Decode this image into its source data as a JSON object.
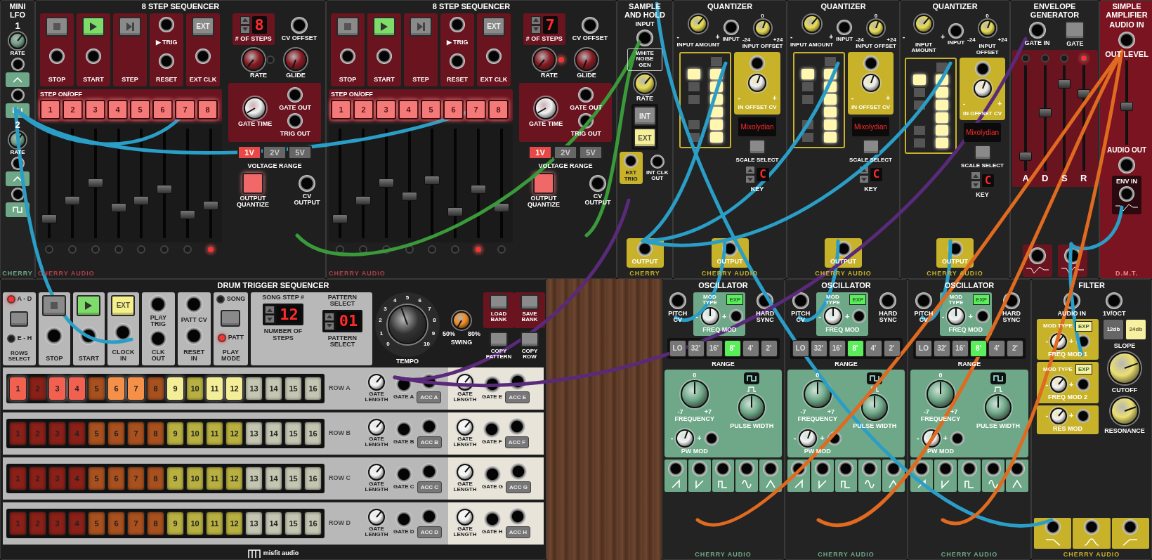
{
  "mini_lfo": {
    "title": "MINI LFO",
    "channels": [
      {
        "number": "1",
        "label": "RATE"
      },
      {
        "number": "2",
        "label": "RATE"
      }
    ],
    "brand": "CHERRY"
  },
  "step_sequencers": [
    {
      "title": "8 STEP SEQUENCER",
      "transport": [
        {
          "kind": "stop",
          "label": "STOP",
          "lit": false
        },
        {
          "kind": "start",
          "label": "START",
          "lit": true
        },
        {
          "kind": "step",
          "label": "STEP",
          "lit": false
        },
        {
          "kind": "reset",
          "label": "RESET",
          "trig": "▶ TRIG"
        },
        {
          "kind": "ext",
          "label": "EXT CLK",
          "button": "EXT",
          "lit": false
        }
      ],
      "steps_count": "8",
      "steps_label": "# OF STEPS",
      "cv_offset": "CV OFFSET",
      "rate": "RATE",
      "rate_led": false,
      "glide": "GLIDE",
      "step_onoff": "STEP ON/OFF",
      "steps": [
        {
          "label": "1",
          "on": true
        },
        {
          "label": "2",
          "on": true
        },
        {
          "label": "3",
          "on": true
        },
        {
          "label": "4",
          "on": true
        },
        {
          "label": "5",
          "on": true
        },
        {
          "label": "6",
          "on": true
        },
        {
          "label": "7",
          "on": true
        },
        {
          "label": "8",
          "on": true
        }
      ],
      "sliders": [
        {
          "level": 0.15
        },
        {
          "level": 0.33
        },
        {
          "level": 0.5
        },
        {
          "level": 0.26
        },
        {
          "level": 0.33
        },
        {
          "level": 0.44
        },
        {
          "level": 0.19
        },
        {
          "level": 0.28
        }
      ],
      "leds": [
        {
          "on": false
        },
        {
          "on": false
        },
        {
          "on": false
        },
        {
          "on": false
        },
        {
          "on": false
        },
        {
          "on": false
        },
        {
          "on": false
        },
        {
          "on": true
        }
      ],
      "gate_time": "GATE TIME",
      "gate_out": "GATE OUT",
      "trig_out": "TRIG OUT",
      "ranges": [
        {
          "label": "1V",
          "selected": true
        },
        {
          "label": "2V",
          "selected": false
        },
        {
          "label": "5V",
          "selected": false
        }
      ],
      "voltage_range": "VOLTAGE RANGE",
      "output_quantize": "OUTPUT QUANTIZE",
      "cv_output": "CV OUTPUT",
      "brand": "CHERRY AUDIO"
    },
    {
      "title": "8 STEP SEQUENCER",
      "transport": [
        {
          "kind": "stop",
          "label": "STOP",
          "lit": false
        },
        {
          "kind": "start",
          "label": "START",
          "lit": true
        },
        {
          "kind": "step",
          "label": "STEP",
          "lit": false
        },
        {
          "kind": "reset",
          "label": "RESET",
          "trig": "▶ TRIG"
        },
        {
          "kind": "ext",
          "label": "EXT CLK",
          "button": "EXT",
          "lit": false
        }
      ],
      "steps_count": "7",
      "steps_label": "# OF STEPS",
      "cv_offset": "CV OFFSET",
      "rate": "RATE",
      "rate_led": true,
      "glide": "GLIDE",
      "step_onoff": "STEP ON/OFF",
      "steps": [
        {
          "label": "1",
          "on": true
        },
        {
          "label": "2",
          "on": true
        },
        {
          "label": "3",
          "on": true
        },
        {
          "label": "4",
          "on": true
        },
        {
          "label": "5",
          "on": true
        },
        {
          "label": "6",
          "on": true
        },
        {
          "label": "7",
          "on": true
        },
        {
          "label": "8",
          "on": true
        }
      ],
      "sliders": [
        {
          "level": 0.15
        },
        {
          "level": 0.33
        },
        {
          "level": 0.5
        },
        {
          "level": 0.37
        },
        {
          "level": 0.53
        },
        {
          "level": 0.22
        },
        {
          "level": 0.44
        },
        {
          "level": 0.26
        }
      ],
      "leds": [
        {
          "on": false
        },
        {
          "on": false
        },
        {
          "on": false
        },
        {
          "on": false
        },
        {
          "on": false
        },
        {
          "on": false
        },
        {
          "on": true
        },
        {
          "on": false
        }
      ],
      "gate_time": "GATE TIME",
      "gate_out": "GATE OUT",
      "trig_out": "TRIG OUT",
      "ranges": [
        {
          "label": "1V",
          "selected": true
        },
        {
          "label": "2V",
          "selected": false
        },
        {
          "label": "5V",
          "selected": false
        }
      ],
      "voltage_range": "VOLTAGE RANGE",
      "output_quantize": "OUTPUT QUANTIZE",
      "cv_output": "CV OUTPUT",
      "brand": "CHERRY AUDIO"
    }
  ],
  "sample_and_hold": {
    "title": "SAMPLE AND HOLD",
    "input": "INPUT",
    "noise": "WHITE NOISE GEN",
    "rate": "RATE",
    "sources": [
      {
        "label": "INT",
        "selected": false
      },
      {
        "label": "EXT",
        "selected": true
      }
    ],
    "ext_trig": "EXT TRIG",
    "int_clk_out": "INT CLK OUT",
    "output": "OUTPUT",
    "brand": "CHERRY"
  },
  "quantizers": [
    {
      "title": "QUANTIZER",
      "input_amount": "INPUT AMOUNT",
      "amount_marks": [
        "-",
        "+"
      ],
      "input": "INPUT",
      "input_offset": "INPUT OFFSET",
      "offset_marks": [
        "0",
        "-24",
        "+24"
      ],
      "keys": [
        {
          "kind": "white",
          "lit": false
        },
        {
          "kind": "black",
          "lit": true
        },
        {
          "kind": "white",
          "lit": true
        },
        {
          "kind": "black",
          "lit": false
        },
        {
          "kind": "white",
          "lit": true
        },
        {
          "kind": "black",
          "lit": false
        },
        {
          "kind": "white",
          "lit": true
        },
        {
          "kind": "white",
          "lit": true
        },
        {
          "kind": "black",
          "lit": false
        },
        {
          "kind": "white",
          "lit": true
        },
        {
          "kind": "black",
          "lit": false
        },
        {
          "kind": "white",
          "lit": true
        }
      ],
      "in_offset_cv": "IN OFFSET CV",
      "cv_marks": [
        "-",
        "+"
      ],
      "scale": "Mixolydian",
      "scale_select": "SCALE SELECT",
      "key": "C",
      "key_label": "KEY",
      "output": "OUTPUT",
      "brand": "CHERRY AUDIO"
    },
    {
      "title": "QUANTIZER",
      "input_amount": "INPUT AMOUNT",
      "amount_marks": [
        "-",
        "+"
      ],
      "input": "INPUT",
      "input_offset": "INPUT OFFSET",
      "offset_marks": [
        "0",
        "-24",
        "+24"
      ],
      "keys": [
        {
          "kind": "white",
          "lit": false
        },
        {
          "kind": "black",
          "lit": true
        },
        {
          "kind": "white",
          "lit": true
        },
        {
          "kind": "black",
          "lit": false
        },
        {
          "kind": "white",
          "lit": true
        },
        {
          "kind": "black",
          "lit": false
        },
        {
          "kind": "white",
          "lit": true
        },
        {
          "kind": "white",
          "lit": true
        },
        {
          "kind": "black",
          "lit": false
        },
        {
          "kind": "white",
          "lit": true
        },
        {
          "kind": "black",
          "lit": false
        },
        {
          "kind": "white",
          "lit": true
        }
      ],
      "in_offset_cv": "IN OFFSET CV",
      "cv_marks": [
        "-",
        "+"
      ],
      "scale": "Mixolydian",
      "scale_select": "SCALE SELECT",
      "key": "C",
      "key_label": "KEY",
      "output": "OUTPUT",
      "brand": "CHERRY AUDIO"
    },
    {
      "title": "QUANTIZER",
      "input_amount": "INPUT AMOUNT",
      "amount_marks": [
        "-",
        "+"
      ],
      "input": "INPUT",
      "input_offset": "INPUT OFFSET",
      "offset_marks": [
        "0",
        "-24",
        "+24"
      ],
      "keys": [
        {
          "kind": "white",
          "lit": false
        },
        {
          "kind": "black",
          "lit": true
        },
        {
          "kind": "white",
          "lit": true
        },
        {
          "kind": "black",
          "lit": false
        },
        {
          "kind": "white",
          "lit": true
        },
        {
          "kind": "black",
          "lit": false
        },
        {
          "kind": "white",
          "lit": true
        },
        {
          "kind": "white",
          "lit": true
        },
        {
          "kind": "black",
          "lit": false
        },
        {
          "kind": "white",
          "lit": true
        },
        {
          "kind": "black",
          "lit": false
        },
        {
          "kind": "white",
          "lit": true
        }
      ],
      "in_offset_cv": "IN OFFSET CV",
      "cv_marks": [
        "-",
        "+"
      ],
      "scale": "Mixolydian",
      "scale_select": "SCALE SELECT",
      "key": "C",
      "key_label": "KEY",
      "output": "OUTPUT",
      "brand": "CHERRY AUDIO"
    }
  ],
  "envelope": {
    "title": "ENVELOPE GENERATOR",
    "gate_in": "GATE IN",
    "gate": "GATE",
    "stages": [
      {
        "label": "A",
        "level": 0.1,
        "led": false
      },
      {
        "label": "D",
        "level": 0.55,
        "led": false
      },
      {
        "label": "S",
        "level": 0.85,
        "led": false
      },
      {
        "label": "R",
        "level": 0.75,
        "led": true
      }
    ]
  },
  "amplifier": {
    "title": "SIMPLE AMPLIFIER",
    "audio_in": "AUDIO IN",
    "out_level": "OUT LEVEL",
    "level": 0.45,
    "audio_out": "AUDIO OUT",
    "env_in": "ENV IN",
    "brand": "D.M.T."
  },
  "drum_sequencer": {
    "title": "DRUM TRIGGER SEQUENCER",
    "rows_select": {
      "options": [
        {
          "label": "A - D",
          "selected": true
        },
        {
          "label": "E - H",
          "selected": false
        }
      ],
      "label": "ROWS SELECT"
    },
    "transport": [
      {
        "kind": "stop",
        "label": "STOP",
        "lit": false
      },
      {
        "kind": "start",
        "label": "START",
        "lit": true
      },
      {
        "kind": "ext",
        "button": "EXT",
        "label": "CLOCK IN",
        "lit": true
      }
    ],
    "io": [
      {
        "top": "PLAY TRIG",
        "bottom": "CLK OUT"
      },
      {
        "top": "PATT CV",
        "bottom": "RESET IN"
      }
    ],
    "play_mode": {
      "options": [
        {
          "label": "SONG",
          "selected": false
        },
        {
          "label": "PATT",
          "selected": true
        }
      ],
      "label": "PLAY MODE"
    },
    "displays": [
      {
        "header": "SONG STEP #",
        "value": "12",
        "label": "NUMBER OF STEPS"
      },
      {
        "header": "PATTERN SELECT",
        "value": "01",
        "label": "PATTERN SELECT"
      }
    ],
    "tempo": {
      "label": "TEMPO",
      "ticks": [
        "0",
        "1",
        "2",
        "3",
        "4",
        "5",
        "6",
        "7",
        "8",
        "9",
        "10"
      ]
    },
    "swing": {
      "min": "50%",
      "max": "80%",
      "label": "SWING"
    },
    "bank": [
      {
        "label": "LOAD BANK",
        "kind": "bank"
      },
      {
        "label": "SAVE BANK",
        "kind": "bank"
      },
      {
        "label": "COPY PATTERN",
        "kind": "copy"
      },
      {
        "label": "COPY ROW",
        "kind": "copy"
      }
    ],
    "rows": [
      {
        "label": "ROW A",
        "steps": [
          {
            "label": "1",
            "on": true
          },
          {
            "label": "2",
            "on": false
          },
          {
            "label": "3",
            "on": true
          },
          {
            "label": "4",
            "on": true
          },
          {
            "label": "5",
            "on": false
          },
          {
            "label": "6",
            "on": true
          },
          {
            "label": "7",
            "on": true
          },
          {
            "label": "8",
            "on": false
          },
          {
            "label": "9",
            "on": true
          },
          {
            "label": "10",
            "on": false
          },
          {
            "label": "11",
            "on": true
          },
          {
            "label": "12",
            "on": true
          },
          {
            "label": "13",
            "on": false
          },
          {
            "label": "14",
            "on": false
          },
          {
            "label": "15",
            "on": false
          },
          {
            "label": "16",
            "on": false
          }
        ],
        "outputs": [
          {
            "gate_length": "GATE LENGTH",
            "gate": "GATE A",
            "acc": "ACC A"
          },
          {
            "gate_length": "GATE LENGTH",
            "gate": "GATE E",
            "acc": "ACC E"
          }
        ]
      },
      {
        "label": "ROW B",
        "steps": [
          {
            "label": "1",
            "on": false
          },
          {
            "label": "2",
            "on": false
          },
          {
            "label": "3",
            "on": false
          },
          {
            "label": "4",
            "on": false
          },
          {
            "label": "5",
            "on": false
          },
          {
            "label": "6",
            "on": false
          },
          {
            "label": "7",
            "on": false
          },
          {
            "label": "8",
            "on": false
          },
          {
            "label": "9",
            "on": false
          },
          {
            "label": "10",
            "on": false
          },
          {
            "label": "11",
            "on": false
          },
          {
            "label": "12",
            "on": false
          },
          {
            "label": "13",
            "on": false
          },
          {
            "label": "14",
            "on": false
          },
          {
            "label": "15",
            "on": false
          },
          {
            "label": "16",
            "on": false
          }
        ],
        "outputs": [
          {
            "gate_length": "GATE LENGTH",
            "gate": "GATE B",
            "acc": "ACC B"
          },
          {
            "gate_length": "GATE LENGTH",
            "gate": "GATE F",
            "acc": "ACC F"
          }
        ]
      },
      {
        "label": "ROW C",
        "steps": [
          {
            "label": "1",
            "on": false
          },
          {
            "label": "2",
            "on": false
          },
          {
            "label": "3",
            "on": false
          },
          {
            "label": "4",
            "on": false
          },
          {
            "label": "5",
            "on": false
          },
          {
            "label": "6",
            "on": false
          },
          {
            "label": "7",
            "on": false
          },
          {
            "label": "8",
            "on": false
          },
          {
            "label": "9",
            "on": false
          },
          {
            "label": "10",
            "on": false
          },
          {
            "label": "11",
            "on": false
          },
          {
            "label": "12",
            "on": false
          },
          {
            "label": "13",
            "on": false
          },
          {
            "label": "14",
            "on": false
          },
          {
            "label": "15",
            "on": false
          },
          {
            "label": "16",
            "on": false
          }
        ],
        "outputs": [
          {
            "gate_length": "GATE LENGTH",
            "gate": "GATE C",
            "acc": "ACC C"
          },
          {
            "gate_length": "GATE LENGTH",
            "gate": "GATE G",
            "acc": "ACC G"
          }
        ]
      },
      {
        "label": "ROW D",
        "steps": [
          {
            "label": "1",
            "on": false
          },
          {
            "label": "2",
            "on": false
          },
          {
            "label": "3",
            "on": false
          },
          {
            "label": "4",
            "on": false
          },
          {
            "label": "5",
            "on": false
          },
          {
            "label": "6",
            "on": false
          },
          {
            "label": "7",
            "on": false
          },
          {
            "label": "8",
            "on": false
          },
          {
            "label": "9",
            "on": false
          },
          {
            "label": "10",
            "on": false
          },
          {
            "label": "11",
            "on": false
          },
          {
            "label": "12",
            "on": false
          },
          {
            "label": "13",
            "on": false
          },
          {
            "label": "14",
            "on": false
          },
          {
            "label": "15",
            "on": false
          },
          {
            "label": "16",
            "on": false
          }
        ],
        "outputs": [
          {
            "gate_length": "GATE LENGTH",
            "gate": "GATE D",
            "acc": "ACC D"
          },
          {
            "gate_length": "GATE LENGTH",
            "gate": "GATE H",
            "acc": "ACC H"
          }
        ]
      }
    ],
    "brand": "misfit audio"
  },
  "oscillators": [
    {
      "title": "OSCILLATOR",
      "pitch_cv": "PITCH CV",
      "mod_type": "MOD TYPE",
      "exp": "EXP",
      "exp_on": true,
      "freq_mod": "FREQ MOD",
      "freq_mod_marks": [
        "-",
        "+"
      ],
      "hard_sync": "HARD SYNC",
      "ranges": [
        {
          "label": "LO",
          "selected": false
        },
        {
          "label": "32'",
          "selected": false
        },
        {
          "label": "16'",
          "selected": false
        },
        {
          "label": "8'",
          "selected": true
        },
        {
          "label": "4'",
          "selected": false
        },
        {
          "label": "2'",
          "selected": false
        }
      ],
      "range": "RANGE",
      "freq_marks": [
        "0",
        "-7",
        "+7"
      ],
      "frequency": "FREQUENCY",
      "pw_mod": "PW MOD",
      "pw_marks": [
        "-",
        "+"
      ],
      "pulse_width": "PULSE WIDTH",
      "brand": "CHERRY AUDIO"
    },
    {
      "title": "OSCILLATOR",
      "pitch_cv": "PITCH CV",
      "mod_type": "MOD TYPE",
      "exp": "EXP",
      "exp_on": true,
      "freq_mod": "FREQ MOD",
      "freq_mod_marks": [
        "-",
        "+"
      ],
      "hard_sync": "HARD SYNC",
      "ranges": [
        {
          "label": "LO",
          "selected": false
        },
        {
          "label": "32'",
          "selected": false
        },
        {
          "label": "16'",
          "selected": false
        },
        {
          "label": "8'",
          "selected": true
        },
        {
          "label": "4'",
          "selected": false
        },
        {
          "label": "2'",
          "selected": false
        }
      ],
      "range": "RANGE",
      "freq_marks": [
        "0",
        "-7",
        "+7"
      ],
      "frequency": "FREQUENCY",
      "pw_mod": "PW MOD",
      "pw_marks": [
        "-",
        "+"
      ],
      "pulse_width": "PULSE WIDTH",
      "brand": "CHERRY AUDIO"
    },
    {
      "title": "OSCILLATOR",
      "pitch_cv": "PITCH CV",
      "mod_type": "MOD TYPE",
      "exp": "EXP",
      "exp_on": true,
      "freq_mod": "FREQ MOD",
      "freq_mod_marks": [
        "-",
        "+"
      ],
      "hard_sync": "HARD SYNC",
      "ranges": [
        {
          "label": "LO",
          "selected": false
        },
        {
          "label": "32'",
          "selected": false
        },
        {
          "label": "16'",
          "selected": false
        },
        {
          "label": "8'",
          "selected": true
        },
        {
          "label": "4'",
          "selected": false
        },
        {
          "label": "2'",
          "selected": false
        }
      ],
      "range": "RANGE",
      "freq_marks": [
        "0",
        "-7",
        "+7"
      ],
      "frequency": "FREQUENCY",
      "pw_mod": "PW MOD",
      "pw_marks": [
        "-",
        "+"
      ],
      "pulse_width": "PULSE WIDTH",
      "brand": "CHERRY AUDIO"
    }
  ],
  "filter": {
    "title": "FILTER",
    "audio_in": "AUDIO IN",
    "v_oct": "1V/OCT",
    "mods": [
      {
        "mod_type": "MOD TYPE",
        "exp": "EXP",
        "label": "FREQ MOD 1",
        "marks": [
          "-",
          "+"
        ]
      },
      {
        "mod_type": "MOD TYPE",
        "exp": "EXP",
        "label": "FREQ MOD 2",
        "marks": [
          "-",
          "+"
        ]
      },
      {
        "label": "RES MOD",
        "marks": [
          "-",
          "+"
        ]
      }
    ],
    "slopes": [
      {
        "label": "12db",
        "selected": false
      },
      {
        "label": "24db",
        "selected": true
      }
    ],
    "slope": "SLOPE",
    "cutoff": "CUTOFF",
    "resonance": "RESONANCE",
    "brand": "CHERRY AUDIO"
  }
}
